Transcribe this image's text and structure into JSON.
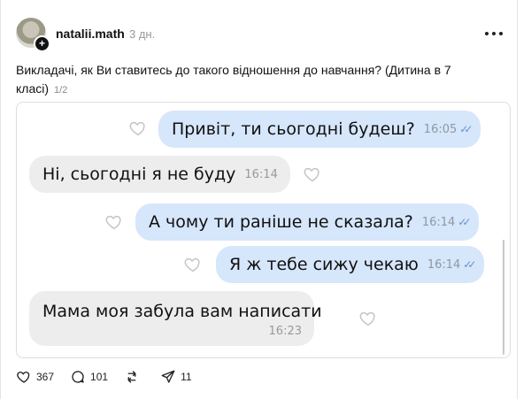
{
  "post": {
    "username": "natalii.math",
    "time": "3 дн.",
    "text": "Викладачі, як Ви ставитесь до такого відношення до навчання? (Дитина в 7 класі)",
    "counter": "1/2"
  },
  "chat": {
    "messages": [
      {
        "direction": "out",
        "text": "Привіт, ти сьогодні будеш?",
        "time": "16:05"
      },
      {
        "direction": "in",
        "text": "Ні, сьогодні я не буду",
        "time": "16:14"
      },
      {
        "direction": "out",
        "text": "А чому ти раніше не сказала?",
        "time": "16:14"
      },
      {
        "direction": "out",
        "text": "Я ж тебе сижу чекаю",
        "time": "16:14"
      },
      {
        "direction": "in",
        "text": "Мама моя забула вам написати",
        "time": "16:23"
      }
    ]
  },
  "actions": {
    "likes": "367",
    "comments": "101",
    "shares": "11"
  },
  "icons": {
    "like": "heart-icon",
    "comment": "comment-bubble-icon",
    "repost": "repost-icon",
    "share": "send-icon",
    "more": "more-icon",
    "follow": "plus-icon"
  },
  "colors": {
    "outgoing_bubble": "#d6e6fb",
    "incoming_bubble": "#ededed",
    "read_ticks": "#6a92c8"
  }
}
